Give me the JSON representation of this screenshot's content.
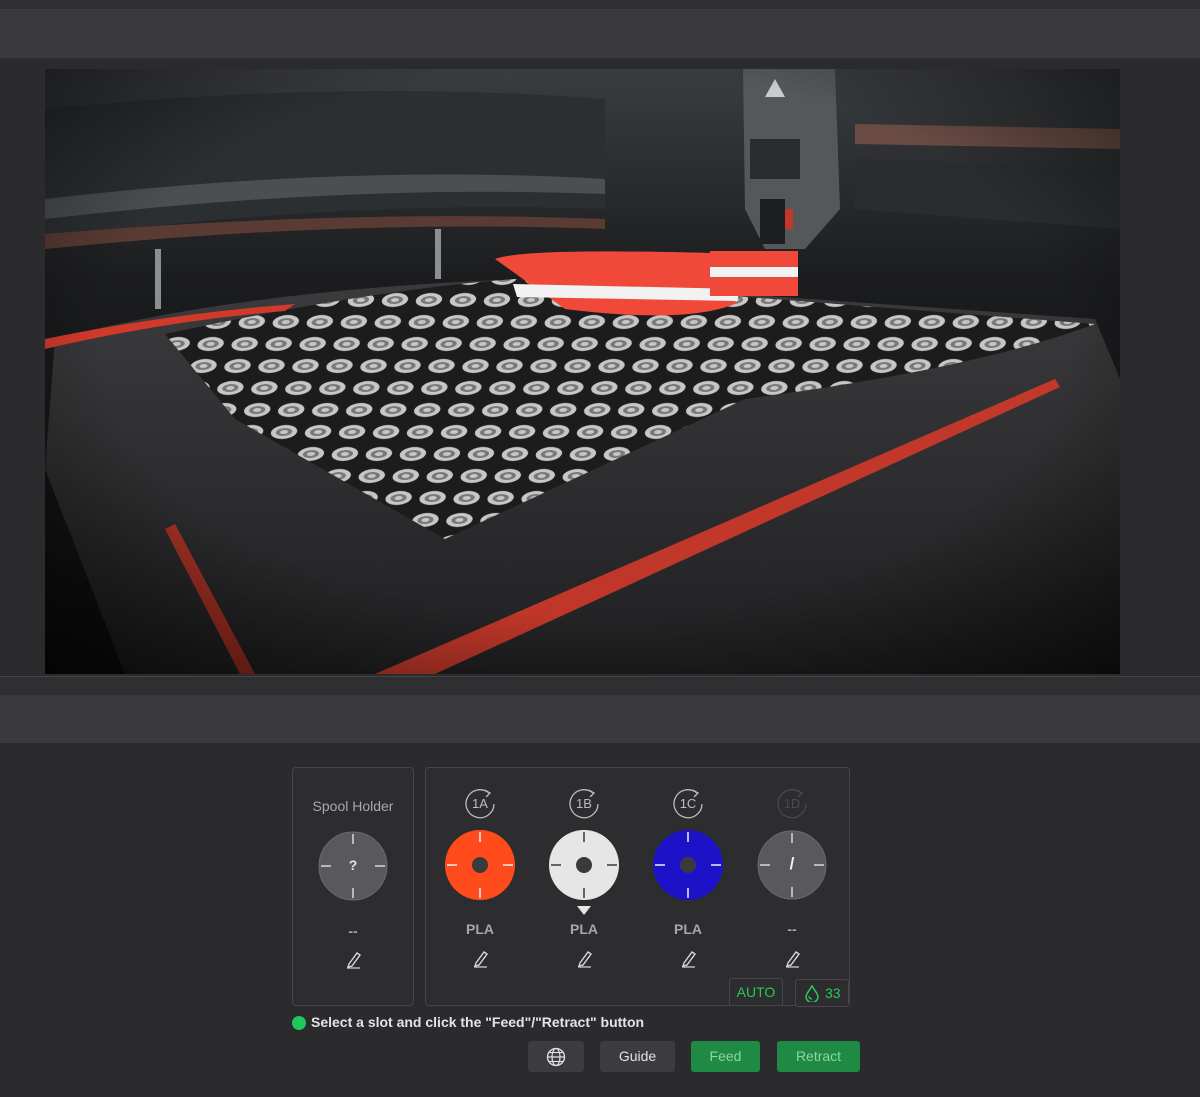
{
  "camera": {
    "description_icon": "camera-feed"
  },
  "spool_holder": {
    "title": "Spool Holder",
    "symbol": "?",
    "material": "--",
    "color": "#58585d"
  },
  "slots": [
    {
      "id": "1A",
      "material": "PLA",
      "color": "#ff4a1c",
      "active": true
    },
    {
      "id": "1B",
      "material": "PLA",
      "color": "#e6e6e6",
      "active": true,
      "selected": true
    },
    {
      "id": "1C",
      "material": "PLA",
      "color": "#1c12c8",
      "active": true
    },
    {
      "id": "1D",
      "material": "--",
      "color": "#58585d",
      "active": false,
      "symbol": "/"
    }
  ],
  "mode": {
    "label": "AUTO"
  },
  "humidity": {
    "value": "33",
    "icon": "droplet-icon"
  },
  "status": {
    "message": "Select a slot and click the \"Feed\"/\"Retract\" button"
  },
  "buttons": {
    "language_icon": "globe-icon",
    "guide": "Guide",
    "feed": "Feed",
    "retract": "Retract"
  },
  "colors": {
    "accent_green": "#22c55e",
    "button_green": "#1f8a43"
  }
}
